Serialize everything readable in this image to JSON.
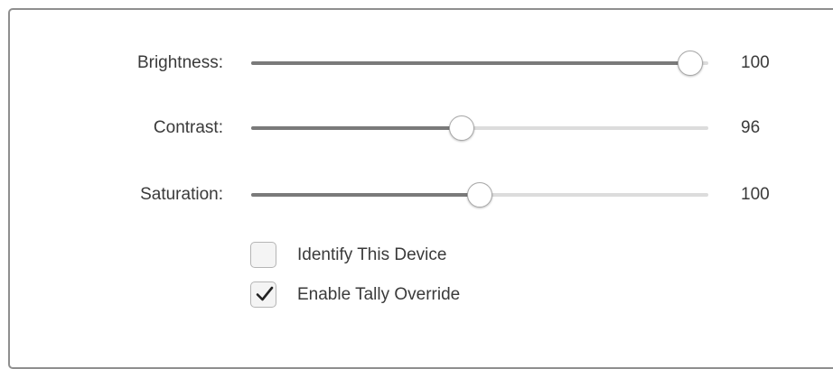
{
  "sliders": [
    {
      "label": "Brightness:",
      "value": "100",
      "fraction": 0.96
    },
    {
      "label": "Contrast:",
      "value": "96",
      "fraction": 0.46
    },
    {
      "label": "Saturation:",
      "value": "100",
      "fraction": 0.5
    }
  ],
  "checkboxes": [
    {
      "label": "Identify This Device",
      "checked": false
    },
    {
      "label": "Enable Tally Override",
      "checked": true
    }
  ],
  "colors": {
    "fill": "#7a7a7a",
    "track": "#dcdcdc",
    "text": "#3a3a3a",
    "border": "#8f8f8f"
  }
}
